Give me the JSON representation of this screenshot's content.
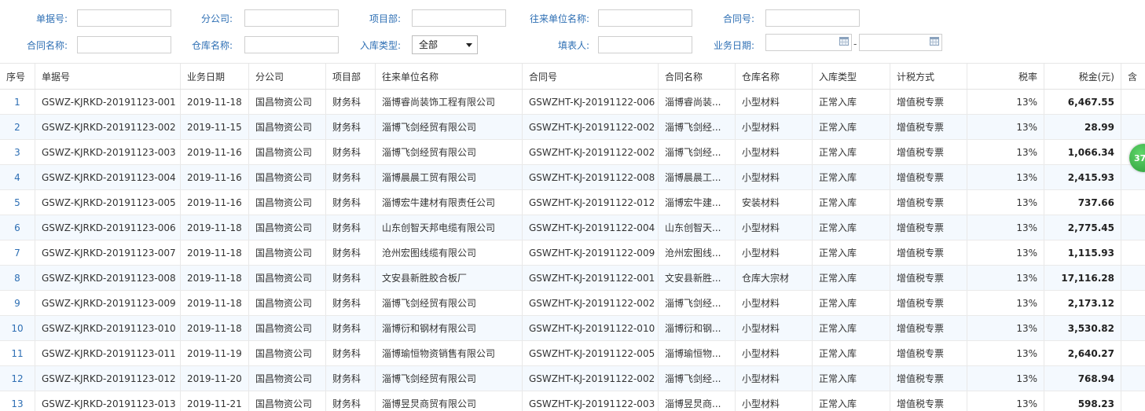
{
  "filters": {
    "doc_no": {
      "label": "单据号:",
      "value": ""
    },
    "branch": {
      "label": "分公司:",
      "value": ""
    },
    "project_dept": {
      "label": "项目部:",
      "value": ""
    },
    "partner": {
      "label": "往来单位名称:",
      "value": ""
    },
    "contract_no": {
      "label": "合同号:",
      "value": ""
    },
    "contract_name": {
      "label": "合同名称:",
      "value": ""
    },
    "warehouse": {
      "label": "仓库名称:",
      "value": ""
    },
    "in_type": {
      "label": "入库类型:",
      "selected": "全部"
    },
    "filler": {
      "label": "填表人:",
      "value": ""
    },
    "biz_date": {
      "label": "业务日期:",
      "from": "",
      "to": "",
      "separator": "-"
    }
  },
  "table": {
    "headers": {
      "seq": "序号",
      "doc_no": "单据号",
      "biz_date": "业务日期",
      "branch": "分公司",
      "project_dept": "项目部",
      "partner": "往来单位名称",
      "contract_no": "合同号",
      "contract_name": "合同名称",
      "warehouse": "仓库名称",
      "in_type": "入库类型",
      "tax_method": "计税方式",
      "tax_rate": "税率",
      "tax_amount": "税金(元)",
      "more": "含"
    },
    "rows": [
      {
        "seq": "1",
        "doc_no": "GSWZ-KJRKD-20191123-001",
        "biz_date": "2019-11-18",
        "branch": "国昌物资公司",
        "project_dept": "财务科",
        "partner": "淄博睿尚装饰工程有限公司",
        "contract_no": "GSWZHT-KJ-20191122-006",
        "contract_name": "淄博睿尚装...",
        "warehouse": "小型材料",
        "in_type": "正常入库",
        "tax_method": "增值税专票",
        "tax_rate": "13%",
        "tax_amount": "6,467.55"
      },
      {
        "seq": "2",
        "doc_no": "GSWZ-KJRKD-20191123-002",
        "biz_date": "2019-11-15",
        "branch": "国昌物资公司",
        "project_dept": "财务科",
        "partner": "淄博飞剑经贸有限公司",
        "contract_no": "GSWZHT-KJ-20191122-002",
        "contract_name": "淄博飞剑经...",
        "warehouse": "小型材料",
        "in_type": "正常入库",
        "tax_method": "增值税专票",
        "tax_rate": "13%",
        "tax_amount": "28.99"
      },
      {
        "seq": "3",
        "doc_no": "GSWZ-KJRKD-20191123-003",
        "biz_date": "2019-11-16",
        "branch": "国昌物资公司",
        "project_dept": "财务科",
        "partner": "淄博飞剑经贸有限公司",
        "contract_no": "GSWZHT-KJ-20191122-002",
        "contract_name": "淄博飞剑经...",
        "warehouse": "小型材料",
        "in_type": "正常入库",
        "tax_method": "增值税专票",
        "tax_rate": "13%",
        "tax_amount": "1,066.34"
      },
      {
        "seq": "4",
        "doc_no": "GSWZ-KJRKD-20191123-004",
        "biz_date": "2019-11-16",
        "branch": "国昌物资公司",
        "project_dept": "财务科",
        "partner": "淄博晨晨工贸有限公司",
        "contract_no": "GSWZHT-KJ-20191122-008",
        "contract_name": "淄博晨晨工...",
        "warehouse": "小型材料",
        "in_type": "正常入库",
        "tax_method": "增值税专票",
        "tax_rate": "13%",
        "tax_amount": "2,415.93"
      },
      {
        "seq": "5",
        "doc_no": "GSWZ-KJRKD-20191123-005",
        "biz_date": "2019-11-16",
        "branch": "国昌物资公司",
        "project_dept": "财务科",
        "partner": "淄博宏牛建材有限责任公司",
        "contract_no": "GSWZHT-KJ-20191122-012",
        "contract_name": "淄博宏牛建...",
        "warehouse": "安装材料",
        "in_type": "正常入库",
        "tax_method": "增值税专票",
        "tax_rate": "13%",
        "tax_amount": "737.66"
      },
      {
        "seq": "6",
        "doc_no": "GSWZ-KJRKD-20191123-006",
        "biz_date": "2019-11-18",
        "branch": "国昌物资公司",
        "project_dept": "财务科",
        "partner": "山东创智天邦电缆有限公司",
        "contract_no": "GSWZHT-KJ-20191122-004",
        "contract_name": "山东创智天...",
        "warehouse": "小型材料",
        "in_type": "正常入库",
        "tax_method": "增值税专票",
        "tax_rate": "13%",
        "tax_amount": "2,775.45"
      },
      {
        "seq": "7",
        "doc_no": "GSWZ-KJRKD-20191123-007",
        "biz_date": "2019-11-18",
        "branch": "国昌物资公司",
        "project_dept": "财务科",
        "partner": "沧州宏图线缆有限公司",
        "contract_no": "GSWZHT-KJ-20191122-009",
        "contract_name": "沧州宏图线...",
        "warehouse": "小型材料",
        "in_type": "正常入库",
        "tax_method": "增值税专票",
        "tax_rate": "13%",
        "tax_amount": "1,115.93"
      },
      {
        "seq": "8",
        "doc_no": "GSWZ-KJRKD-20191123-008",
        "biz_date": "2019-11-18",
        "branch": "国昌物资公司",
        "project_dept": "财务科",
        "partner": "文安县新胜胶合板厂",
        "contract_no": "GSWZHT-KJ-20191122-001",
        "contract_name": "文安县新胜...",
        "warehouse": "仓库大宗材",
        "in_type": "正常入库",
        "tax_method": "增值税专票",
        "tax_rate": "13%",
        "tax_amount": "17,116.28"
      },
      {
        "seq": "9",
        "doc_no": "GSWZ-KJRKD-20191123-009",
        "biz_date": "2019-11-18",
        "branch": "国昌物资公司",
        "project_dept": "财务科",
        "partner": "淄博飞剑经贸有限公司",
        "contract_no": "GSWZHT-KJ-20191122-002",
        "contract_name": "淄博飞剑经...",
        "warehouse": "小型材料",
        "in_type": "正常入库",
        "tax_method": "增值税专票",
        "tax_rate": "13%",
        "tax_amount": "2,173.12"
      },
      {
        "seq": "10",
        "doc_no": "GSWZ-KJRKD-20191123-010",
        "biz_date": "2019-11-18",
        "branch": "国昌物资公司",
        "project_dept": "财务科",
        "partner": "淄博衍和钢材有限公司",
        "contract_no": "GSWZHT-KJ-20191122-010",
        "contract_name": "淄博衍和钢...",
        "warehouse": "小型材料",
        "in_type": "正常入库",
        "tax_method": "增值税专票",
        "tax_rate": "13%",
        "tax_amount": "3,530.82"
      },
      {
        "seq": "11",
        "doc_no": "GSWZ-KJRKD-20191123-011",
        "biz_date": "2019-11-19",
        "branch": "国昌物资公司",
        "project_dept": "财务科",
        "partner": "淄博瑜恒物资销售有限公司",
        "contract_no": "GSWZHT-KJ-20191122-005",
        "contract_name": "淄博瑜恒物...",
        "warehouse": "小型材料",
        "in_type": "正常入库",
        "tax_method": "增值税专票",
        "tax_rate": "13%",
        "tax_amount": "2,640.27"
      },
      {
        "seq": "12",
        "doc_no": "GSWZ-KJRKD-20191123-012",
        "biz_date": "2019-11-20",
        "branch": "国昌物资公司",
        "project_dept": "财务科",
        "partner": "淄博飞剑经贸有限公司",
        "contract_no": "GSWZHT-KJ-20191122-002",
        "contract_name": "淄博飞剑经...",
        "warehouse": "小型材料",
        "in_type": "正常入库",
        "tax_method": "增值税专票",
        "tax_rate": "13%",
        "tax_amount": "768.94"
      },
      {
        "seq": "13",
        "doc_no": "GSWZ-KJRKD-20191123-013",
        "biz_date": "2019-11-21",
        "branch": "国昌物资公司",
        "project_dept": "财务科",
        "partner": "淄博昱炅商贸有限公司",
        "contract_no": "GSWZHT-KJ-20191122-003",
        "contract_name": "淄博昱炅商...",
        "warehouse": "小型材料",
        "in_type": "正常入库",
        "tax_method": "增值税专票",
        "tax_rate": "13%",
        "tax_amount": "598.23"
      }
    ]
  },
  "badge": {
    "text": "37"
  },
  "colors": {
    "label_blue": "#2e6fb4",
    "row_alt": "#f4f9fe",
    "badge_green": "#2c9b3a"
  }
}
